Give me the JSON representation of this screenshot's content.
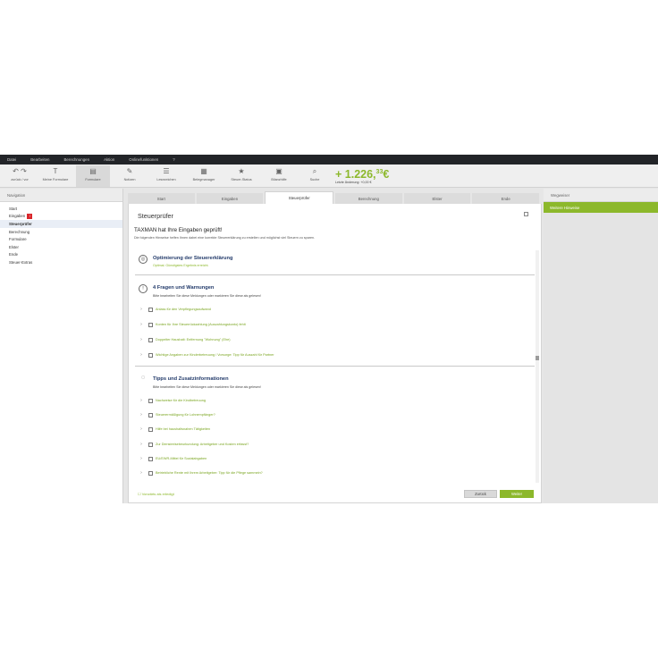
{
  "menubar": [
    "Datei",
    "Bearbeiten",
    "Berechnungen",
    "Aktion",
    "Onlinefunktionen",
    "?"
  ],
  "toolbar": {
    "buttons": [
      {
        "icon": "undo-redo-icon",
        "glyph": "↶ ↷",
        "label": "zurück / vor"
      },
      {
        "icon": "text-icon",
        "glyph": "T",
        "label": "Meine Formulare"
      },
      {
        "icon": "form-icon",
        "glyph": "▤",
        "label": "Formulare"
      },
      {
        "icon": "pen-icon",
        "glyph": "✎",
        "label": "Notizen"
      },
      {
        "icon": "list-icon",
        "glyph": "☰",
        "label": "Lesezeichen"
      },
      {
        "icon": "calendar-icon",
        "glyph": "▦",
        "label": "Belegmanager"
      },
      {
        "icon": "star-icon",
        "glyph": "★",
        "label": "Steuer-Status"
      },
      {
        "icon": "calculator-icon",
        "glyph": "▣",
        "label": "Bilanzhilfe"
      },
      {
        "icon": "search-icon",
        "glyph": "⌕",
        "label": "Suche"
      }
    ],
    "refund": {
      "prefix": "+ ",
      "amount": "1.226,",
      "cents": "33",
      "currency": "€",
      "sub": "Letzte Änderung: +0,00 €"
    }
  },
  "left": {
    "heading": "Navigation",
    "items": [
      "Start",
      "Eingaben",
      "Steuerprüfer",
      "Berechnung",
      "Formulare",
      "Elster",
      "Ende",
      "Steuer-Extras"
    ],
    "selected_index": 2,
    "badge_text": "!"
  },
  "tabs": [
    "Start",
    "Eingaben",
    "Steuerprüfer",
    "Berechnung",
    "Elster",
    "Ende"
  ],
  "active_tab": 2,
  "main": {
    "title": "Steuerprüfer",
    "print_label": "⎙",
    "headline": "TAXMAN hat Ihre Eingaben geprüft!",
    "subline": "Die folgenden Hinweise helfen Ihnen dabei eine korrekte Steuererklärung zu erstellen und möglichst viel Steuern zu sparen.",
    "sections": [
      {
        "icon": "optimization-icon",
        "glyph": "◎",
        "title": "Optimierung der Steuererklärung",
        "desc": "",
        "link": "Optimal. Günstigstes Ergebnis erreicht.",
        "rows": []
      },
      {
        "icon": "warning-icon",
        "glyph": "!",
        "title": "4 Fragen und Warnungen",
        "desc": "Bitte bearbeiten Sie diese Meldungen oder markieren Sie diese als gelesen!",
        "link": "",
        "rows": [
          "Anlass für den Verpflegungsaufwand",
          "Konten für Ihre Steuerrückzahlung (Auszahlungskonto) fehlt",
          "Doppelter Haushalt: Entfernung \"Wohnung\" (Ehe)",
          "Wichtige Angaben zur Kinderbetreuung / Vorsorge: Tipp für Auszahl für Partner"
        ]
      },
      {
        "icon": "lightbulb-icon",
        "glyph": "💡",
        "title": "Tipps und Zusatzinformationen",
        "desc": "Bitte bearbeiten Sie diese Meldungen oder markieren Sie diese als gelesen!",
        "link": "",
        "rows": [
          "Nachweise für die Kindbetreuung",
          "Steuerermäßigung für Lohnempfänger?",
          "Hilfe bei haushaltsnahen Tätigkeiten",
          "Zur Dienstreisebeurkundung: Arbeitgeber und Kosten erfasst?",
          "EU/EWR-Mittel für Sozialabgaben",
          "Betriebliche Rente mit Ihrem Arbeitgeber: Tipp für die Pflege sammeln?"
        ]
      }
    ],
    "footer_checkbox": "☐ Vorwärts als erledigt",
    "back_label": "Zurück",
    "next_label": "Weiter"
  },
  "right": {
    "heading": "Wegweiser",
    "active_item": "Weitere Hinweise"
  },
  "colors": {
    "accent": "#8cb82b",
    "menubar": "#222428",
    "title": "#223a6a"
  }
}
